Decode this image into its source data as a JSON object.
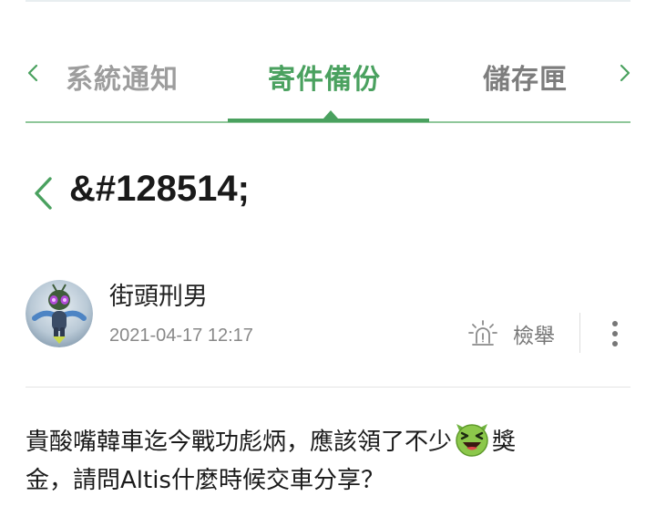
{
  "tabs": {
    "prev_label": "系統通知",
    "active_label": "寄件備份",
    "next_label": "儲存匣",
    "left_arrow_icon": "chevron-left-icon",
    "right_arrow_icon": "chevron-right-icon"
  },
  "post": {
    "title": "&#128514;",
    "back_icon": "chevron-left-icon",
    "author": "街頭刑男",
    "date": "2021-04-17 12:17",
    "report_label": "檢舉",
    "report_icon": "siren-icon",
    "more_icon": "more-vertical-icon",
    "body_part1": "貴酸嘴韓車迄今戰功彪炳，應該領了不少",
    "body_emoji": "grinning-squint-emoji",
    "body_part2": "獎",
    "body_line2": "金，請問Altis什麼時候交車分享？"
  },
  "colors": {
    "accent": "#4aa15f",
    "accent_light": "#8fc79a",
    "muted_text": "#888888"
  }
}
